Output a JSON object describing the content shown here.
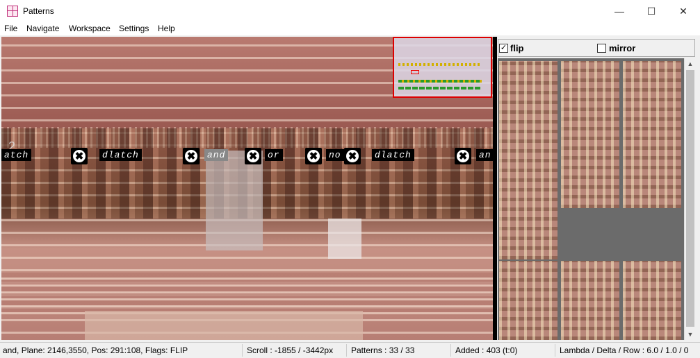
{
  "window": {
    "title": "Patterns",
    "minimize_glyph": "—",
    "maximize_glyph": "☐",
    "close_glyph": "✕"
  },
  "menu": {
    "items": [
      "File",
      "Navigate",
      "Workspace",
      "Settings",
      "Help"
    ]
  },
  "canvas": {
    "row_marker": "2",
    "labels": [
      {
        "text": "atch",
        "selected": false
      },
      {
        "text": "dlatch",
        "selected": false
      },
      {
        "text": "and",
        "selected": true
      },
      {
        "text": "or",
        "selected": false
      },
      {
        "text": "no",
        "selected": false
      },
      {
        "text": "dlatch",
        "selected": false
      },
      {
        "text": "an",
        "selected": false
      }
    ],
    "remove_glyph": "✖"
  },
  "sidebar": {
    "flip_label": "flip",
    "flip_checked": true,
    "mirror_label": "mirror",
    "mirror_checked": false,
    "check_glyph": "✓",
    "scroll_up_glyph": "▲",
    "scroll_down_glyph": "▼"
  },
  "status": {
    "pattern_info": "and, Plane: 2146,3550, Pos: 291:108, Flags: FLIP",
    "scroll": "Scroll : -1855 / -3442px",
    "patterns": "Patterns : 33 / 33",
    "added": "Added : 403 (t:0)",
    "lambda": "Lambda / Delta / Row : 6.0 / 1.0 / 0"
  },
  "colors": {
    "label_bg": "#000000",
    "selected_label_bg": "#888888",
    "minimap_border": "#dd0000",
    "thumb_pane_bg": "#6b6b6b"
  }
}
